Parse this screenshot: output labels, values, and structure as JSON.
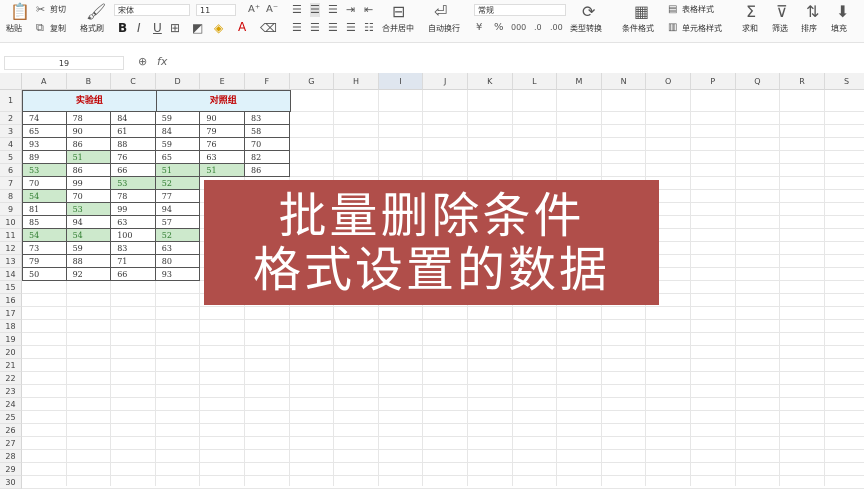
{
  "ribbon": {
    "paste": "粘贴",
    "cut": "剪切",
    "copy": "复制",
    "format_painter": "格式刷",
    "font_name": "宋体",
    "font_size": "11",
    "merge_center": "合并居中",
    "wrap_text": "自动换行",
    "number_format": "常规",
    "type_convert": "类型转换",
    "conditional_format": "条件格式",
    "table_style": "表格样式",
    "cell_style": "单元格样式",
    "sum": "求和",
    "filter": "筛选",
    "sort": "排序",
    "fill": "填充"
  },
  "formula_bar": {
    "name_box": "19",
    "fx_label": "fx"
  },
  "columns": [
    "A",
    "B",
    "C",
    "D",
    "E",
    "F",
    "G",
    "H",
    "I",
    "J",
    "K",
    "L",
    "M",
    "N",
    "O",
    "P",
    "Q",
    "R",
    "S"
  ],
  "selected_column": "I",
  "rows": [
    "1",
    "2",
    "3",
    "4",
    "5",
    "6",
    "7",
    "8",
    "9",
    "10",
    "11",
    "12",
    "13",
    "14",
    "15",
    "16",
    "17",
    "18",
    "19",
    "20",
    "21",
    "22",
    "23",
    "24",
    "25",
    "26",
    "27",
    "28",
    "29",
    "30"
  ],
  "table": {
    "group_headers": [
      "实验组",
      "对照组"
    ],
    "data": [
      [
        "74",
        "78",
        "84",
        "59",
        "90",
        "83"
      ],
      [
        "65",
        "90",
        "61",
        "84",
        "79",
        "58"
      ],
      [
        "93",
        "86",
        "88",
        "59",
        "76",
        "70"
      ],
      [
        "89",
        "51",
        "76",
        "65",
        "63",
        "82"
      ],
      [
        "53",
        "86",
        "66",
        "51",
        "51",
        "86"
      ],
      [
        "70",
        "99",
        "53",
        "52",
        "",
        ""
      ],
      [
        "54",
        "70",
        "78",
        "77",
        "",
        ""
      ],
      [
        "81",
        "53",
        "99",
        "94",
        "",
        ""
      ],
      [
        "85",
        "94",
        "63",
        "57",
        "",
        ""
      ],
      [
        "54",
        "54",
        "100",
        "52",
        "",
        ""
      ],
      [
        "73",
        "59",
        "83",
        "63",
        "",
        ""
      ],
      [
        "79",
        "88",
        "71",
        "80",
        "",
        ""
      ],
      [
        "50",
        "92",
        "66",
        "93",
        "",
        ""
      ]
    ],
    "highlight_color": "#cde9cc"
  },
  "overlay": {
    "line1": "批量删除条件",
    "line2": "格式设置的数据",
    "background": "#b04e4a"
  }
}
